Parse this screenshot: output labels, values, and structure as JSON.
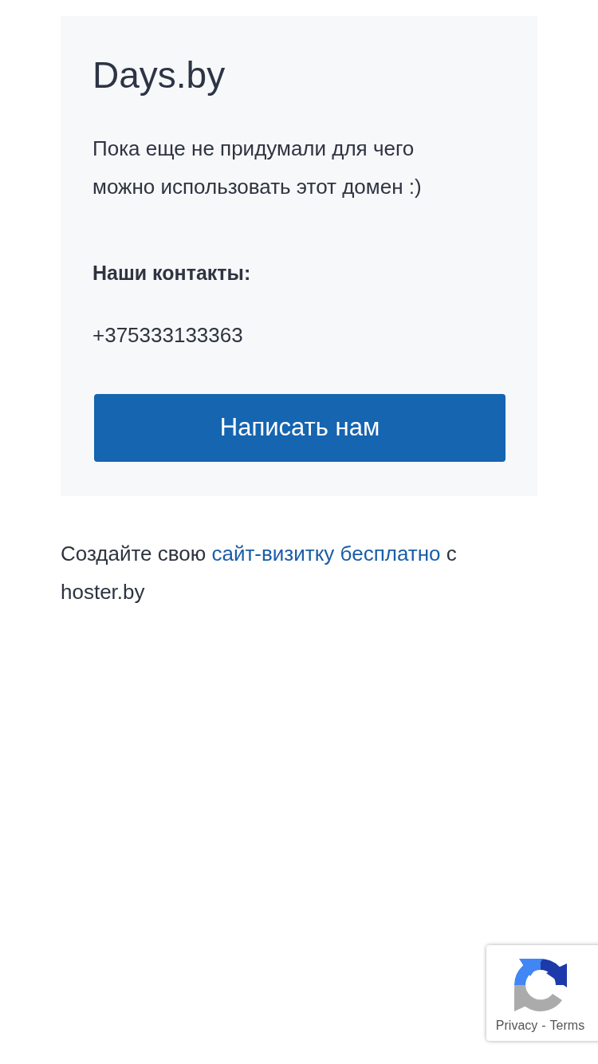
{
  "card": {
    "title": "Days.by",
    "description": "Пока еще не придумали для чего можно использовать этот домен :)",
    "contacts_heading": "Наши контакты:",
    "phone": "+375333133363",
    "button": "Написать нам"
  },
  "footer": {
    "prefix": "Создайте свою ",
    "link": "сайт-визитку бесплатно",
    "suffix": " с hoster.by"
  },
  "recaptcha": {
    "privacy": "Privacy",
    "separator": "-",
    "terms": "Terms"
  }
}
